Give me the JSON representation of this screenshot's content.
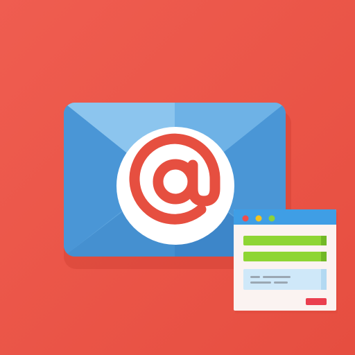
{
  "icon_name": "email-form-icon",
  "colors": {
    "background": "#e8503f",
    "envelope_light": "#73b6e6",
    "envelope_mid": "#5aa2dc",
    "envelope_dark": "#3d86c9",
    "seal": "#ffffff",
    "at_symbol": "#e64f40",
    "window_titlebar": "#3f9ee5",
    "window_body": "#fbf3f1",
    "dot_red": "#ee4d4d",
    "dot_yellow": "#f3c31e",
    "dot_green": "#8cd23a",
    "field_green": "#8ed534",
    "field_blue": "#cfe8f9",
    "placeholder_gray": "#9aa7b3",
    "submit_red": "#ea3f4f"
  }
}
